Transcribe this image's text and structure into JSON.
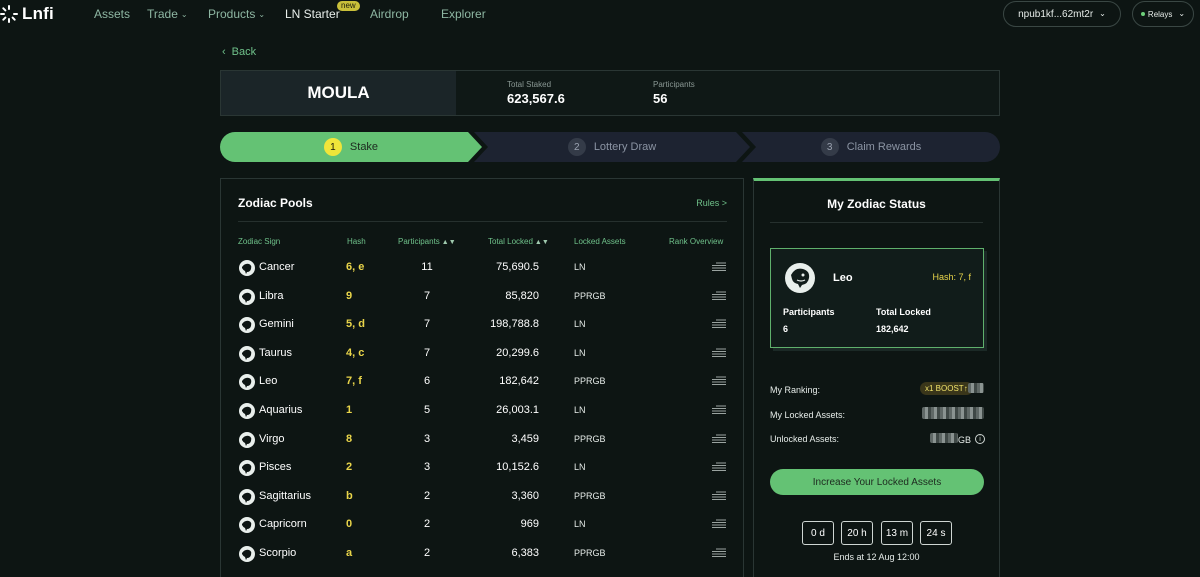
{
  "nav": {
    "logo": "Lnfi",
    "links": [
      {
        "label": "Assets"
      },
      {
        "label": "Trade",
        "chevron": "⌄"
      },
      {
        "label": "Products",
        "chevron": "⌄"
      },
      {
        "label": "LN Starter"
      },
      {
        "label": "Airdrop"
      },
      {
        "label": "Explorer"
      }
    ],
    "new_badge": "new",
    "wallet": "npub1kf...62mt2r",
    "wallet_chevron": "⌄",
    "relays": "Relays",
    "relays_chevron": "⌄"
  },
  "back": "Back",
  "project": {
    "name": "MOULA",
    "total_staked_label": "Total Staked",
    "total_staked": "623,567.6",
    "participants_label": "Participants",
    "participants": "56"
  },
  "steps": [
    {
      "num": "1",
      "label": "Stake",
      "active": true
    },
    {
      "num": "2",
      "label": "Lottery Draw",
      "active": false
    },
    {
      "num": "3",
      "label": "Claim Rewards",
      "active": false
    }
  ],
  "pools": {
    "title": "Zodiac Pools",
    "rules": "Rules >",
    "columns": {
      "sign": "Zodiac Sign",
      "hash": "Hash",
      "participants": "Participants",
      "total_locked": "Total Locked",
      "locked_assets": "Locked Assets",
      "rank": "Rank Overview"
    },
    "sort_icon": "▲▼",
    "rows": [
      {
        "sign": "Cancer",
        "icon": "crab-icon",
        "hash": "6, e",
        "participants": "11",
        "locked": "75,690.5",
        "asset": "LN"
      },
      {
        "sign": "Libra",
        "icon": "scales-icon",
        "hash": "9",
        "participants": "7",
        "locked": "85,820",
        "asset": "PPRGB"
      },
      {
        "sign": "Gemini",
        "icon": "twins-icon",
        "hash": "5, d",
        "participants": "7",
        "locked": "198,788.8",
        "asset": "LN"
      },
      {
        "sign": "Taurus",
        "icon": "bull-icon",
        "hash": "4, c",
        "participants": "7",
        "locked": "20,299.6",
        "asset": "LN"
      },
      {
        "sign": "Leo",
        "icon": "lion-icon",
        "hash": "7, f",
        "participants": "6",
        "locked": "182,642",
        "asset": "PPRGB"
      },
      {
        "sign": "Aquarius",
        "icon": "water-bearer-icon",
        "hash": "1",
        "participants": "5",
        "locked": "26,003.1",
        "asset": "LN"
      },
      {
        "sign": "Virgo",
        "icon": "maiden-icon",
        "hash": "8",
        "participants": "3",
        "locked": "3,459",
        "asset": "PPRGB"
      },
      {
        "sign": "Pisces",
        "icon": "fish-icon",
        "hash": "2",
        "participants": "3",
        "locked": "10,152.6",
        "asset": "LN"
      },
      {
        "sign": "Sagittarius",
        "icon": "archer-icon",
        "hash": "b",
        "participants": "2",
        "locked": "3,360",
        "asset": "PPRGB"
      },
      {
        "sign": "Capricorn",
        "icon": "goat-icon",
        "hash": "0",
        "participants": "2",
        "locked": "969",
        "asset": "LN"
      },
      {
        "sign": "Scorpio",
        "icon": "scorpion-icon",
        "hash": "a",
        "participants": "2",
        "locked": "6,383",
        "asset": "PPRGB"
      }
    ]
  },
  "status": {
    "title": "My Zodiac Status",
    "sign": "Leo",
    "hash": "Hash: 7, f",
    "participants_label": "Participants",
    "participants": "6",
    "total_locked_label": "Total Locked",
    "total_locked": "182,642",
    "ranking_label": "My Ranking:",
    "boost": "x1 BOOST",
    "boost_arrow": "↑",
    "locked_assets_label": "My Locked Assets:",
    "unlocked_assets_label": "Unlocked Assets:",
    "unlocked_assets_suffix": "GB",
    "info_glyph": "i",
    "increase_button": "Increase Your Locked Assets",
    "countdown": [
      "0 d",
      "20 h",
      "13 m",
      "24 s"
    ],
    "ends": "Ends at 12 Aug 12:00"
  },
  "colors": {
    "accent_green": "#64c274",
    "hash_yellow": "#e9d54a",
    "background": "#0d1513"
  }
}
